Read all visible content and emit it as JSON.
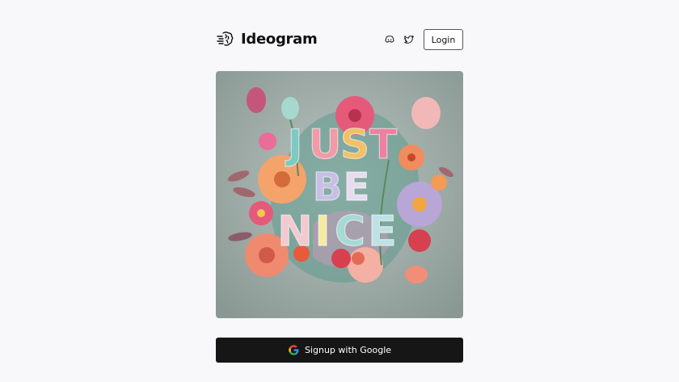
{
  "header": {
    "brand_name": "Ideogram",
    "logo_icon": "ideogram-brain-icon",
    "social_icons": [
      "discord-icon",
      "twitter-icon"
    ],
    "login_label": "Login"
  },
  "hero": {
    "artwork_lines": [
      "JUST",
      "BE",
      "NICE"
    ],
    "background_color": "#9aa9a5"
  },
  "signup": {
    "label": "Signup with Google",
    "icon": "google-icon",
    "background_color": "#161616"
  }
}
